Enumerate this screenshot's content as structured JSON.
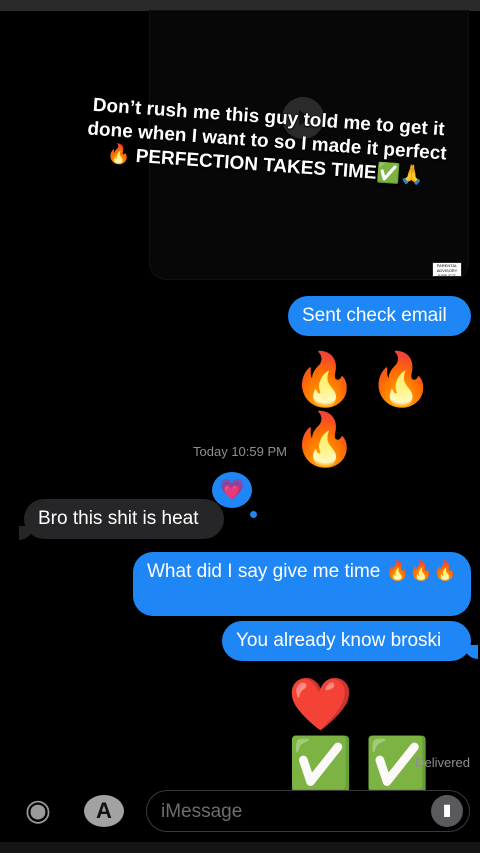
{
  "top_media": {
    "caption": "Don’t rush me this guy told me to get it done when I want to so I made it perfect 🔥 PERFECTION TAKES TIME✅🙏",
    "advisory": "PARENTAL ADVISORY EXPLICIT CONTENT",
    "play_icon": "play-icon"
  },
  "messages": {
    "sent_check_email": "Sent check email",
    "fires": "🔥🔥🔥",
    "timestamp": "Today 10:59 PM",
    "reaction": "💗",
    "incoming": "Bro this shit is heat",
    "reply1": "What did I say give me time 🔥🔥🔥",
    "reply2": "You already know broski",
    "emoji_reply": "❤️✅✅",
    "delivered": "Delivered"
  },
  "composer": {
    "camera_icon": "camera-icon",
    "appstore_icon": "app-store-icon",
    "placeholder": "iMessage",
    "audio_icon": "audio-waveform-icon"
  }
}
